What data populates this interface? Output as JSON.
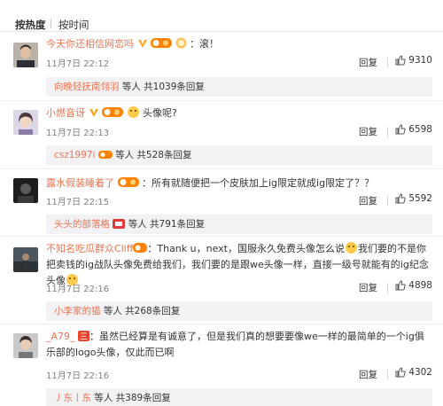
{
  "tabs": {
    "hot": "按热度",
    "time": "按时间"
  },
  "comments": [
    {
      "user": "今天你还相信网恋吗",
      "text": "：滚！",
      "date": "11月7日 22:12",
      "reply": "回复",
      "likes": "9310",
      "sub_user": "向晚轻抚南翎羽",
      "sub_rest": "等人 共1039条回复"
    },
    {
      "user": "小燃音讶",
      "text": "头像呢?",
      "date": "11月7日 22:13",
      "reply": "回复",
      "likes": "6598",
      "sub_user": "csz1997i",
      "sub_rest": "等人 共528条回复"
    },
    {
      "user": "露水假装睡着了",
      "text": "：所有就随便把一个皮肤加上ig限定就成ig限定了？？",
      "date": "11月7日 22:15",
      "reply": "回复",
      "likes": "5592",
      "sub_user": "头头的部落格",
      "sub_rest": "等人 共791条回复"
    },
    {
      "user": "不知名吃瓜群众Cliff",
      "text": "：Thank u，next，国服永久免费头像怎么说",
      "text_b": "我们要的不是你把卖钱的ig战队头像免费给我们，我们要的是跟we头像一样，直接一级号就能有的ig纪念头像",
      "date": "11月7日 22:16",
      "reply": "回复",
      "likes": "4898",
      "sub_user": "小李家的猫",
      "sub_rest": "等人 共268条回复"
    },
    {
      "user": "_A79_",
      "text": "：虽然已经算是有诚意了，但是我们真的想要要像we一样的最简单的一个ig俱乐部的logo头像，仅此而已啊",
      "date": "11月7日 22:16",
      "reply": "回复",
      "likes": "4302",
      "sub_user": "丿东丨东",
      "sub_rest": "等人 共389条回复"
    }
  ]
}
